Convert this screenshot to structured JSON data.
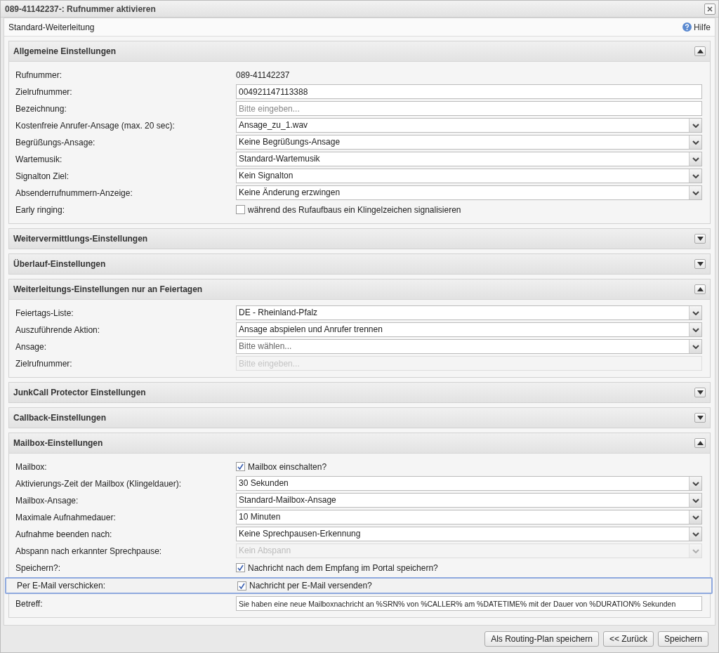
{
  "window": {
    "title": "089-41142237-: Rufnummer aktivieren"
  },
  "header": {
    "title": "Standard-Weiterleitung",
    "help": "Hilfe"
  },
  "sections": [
    {
      "title": "Allgemeine Einstellungen",
      "expanded": true,
      "rows": [
        {
          "kind": "text",
          "label": "Rufnummer:",
          "value": "089-41142237"
        },
        {
          "kind": "input",
          "label": "Zielrufnummer:",
          "value": "004921147113388",
          "disabled": false
        },
        {
          "kind": "input",
          "label": "Bezeichnung:",
          "placeholder": "Bitte eingeben...",
          "disabled": false
        },
        {
          "kind": "select",
          "label": "Kostenfreie Anrufer-Ansage (max. 20 sec):",
          "value": "Ansage_zu_1.wav",
          "disabled": false
        },
        {
          "kind": "select",
          "label": "Begrüßungs-Ansage:",
          "value": "Keine Begrüßungs-Ansage",
          "disabled": false
        },
        {
          "kind": "select",
          "label": "Wartemusik:",
          "value": "Standard-Wartemusik",
          "disabled": false
        },
        {
          "kind": "select",
          "label": "Signalton Ziel:",
          "value": "Kein Signalton",
          "disabled": false
        },
        {
          "kind": "select",
          "label": "Absenderrufnummern-Anzeige:",
          "value": "Keine Änderung erzwingen",
          "disabled": false
        },
        {
          "kind": "checkbox",
          "label": "Early ringing:",
          "value": "während des Rufaufbaus ein Klingelzeichen signalisieren",
          "checked": false
        }
      ]
    },
    {
      "title": "Weitervermittlungs-Einstellungen",
      "expanded": false
    },
    {
      "title": "Überlauf-Einstellungen",
      "expanded": false
    },
    {
      "title": "Weiterleitungs-Einstellungen nur an Feiertagen",
      "expanded": true,
      "rows": [
        {
          "kind": "select",
          "label": "Feiertags-Liste:",
          "value": "DE - Rheinland-Pfalz",
          "disabled": false
        },
        {
          "kind": "select",
          "label": "Auszuführende Aktion:",
          "value": "Ansage abspielen und Anrufer trennen",
          "disabled": false
        },
        {
          "kind": "select",
          "label": "Ansage:",
          "placeholder": "Bitte wählen...",
          "disabled": false
        },
        {
          "kind": "input",
          "label": "Zielrufnummer:",
          "placeholder": "Bitte eingeben...",
          "disabled": true
        }
      ]
    },
    {
      "title": "JunkCall Protector Einstellungen",
      "expanded": false
    },
    {
      "title": "Callback-Einstellungen",
      "expanded": false
    },
    {
      "title": "Mailbox-Einstellungen",
      "expanded": true,
      "rows": [
        {
          "kind": "checkbox",
          "label": "Mailbox:",
          "value": "Mailbox einschalten?",
          "checked": true,
          "highlighted": false
        },
        {
          "kind": "select",
          "label": "Aktivierungs-Zeit der Mailbox (Klingeldauer):",
          "value": "30 Sekunden",
          "disabled": false,
          "highlighted": false
        },
        {
          "kind": "select",
          "label": "Mailbox-Ansage:",
          "value": "Standard-Mailbox-Ansage",
          "disabled": false,
          "highlighted": false
        },
        {
          "kind": "select",
          "label": "Maximale Aufnahmedauer:",
          "value": "10 Minuten",
          "disabled": false,
          "highlighted": false
        },
        {
          "kind": "select",
          "label": "Aufnahme beenden nach:",
          "value": "Keine Sprechpausen-Erkennung",
          "disabled": false,
          "highlighted": false
        },
        {
          "kind": "select",
          "label": "Abspann nach erkannter Sprechpause:",
          "value": "Kein Abspann",
          "disabled": true,
          "highlighted": false
        },
        {
          "kind": "checkbox",
          "label": "Speichern?:",
          "value": "Nachricht nach dem Empfang im Portal speichern?",
          "checked": true,
          "highlighted": false
        },
        {
          "kind": "checkbox",
          "label": "Per E-Mail verschicken:",
          "value": "Nachricht per E-Mail versenden?",
          "checked": true,
          "highlighted": true
        },
        {
          "kind": "input",
          "label": "Betreff:",
          "value": "Sie haben eine neue Mailboxnachricht an %SRN% von %CALLER% am %DATETIME% mit der Dauer von %DURATION% Sekunden",
          "disabled": false,
          "highlighted": false
        }
      ]
    }
  ],
  "buttons": [
    "Als Routing-Plan speichern",
    "<< Zurück",
    "Speichern"
  ]
}
